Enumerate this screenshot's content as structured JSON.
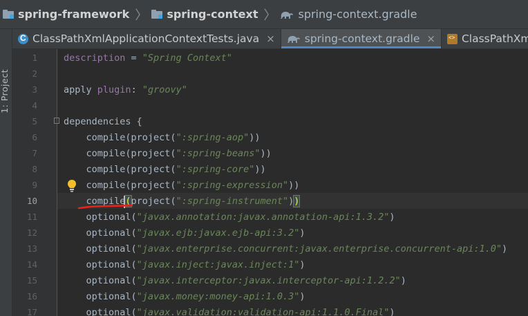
{
  "breadcrumb": {
    "items": [
      "spring-framework",
      "spring-context",
      "spring-context.gradle"
    ],
    "separator": "〉"
  },
  "tabs": [
    {
      "label": "ClassPathXmlApplicationContextTests.java",
      "icon": "java-class-icon",
      "active": false
    },
    {
      "label": "spring-context.gradle",
      "icon": "gradle-elephant-icon",
      "active": true
    },
    {
      "label": "ClassPathXmlAppl",
      "icon": "xml-file-icon",
      "active": false
    }
  ],
  "tab_close_glyph": "×",
  "toolwindow": {
    "project_label": "1: Project"
  },
  "gutter": {
    "line_numbers": [
      "1",
      "2",
      "3",
      "4",
      "5",
      "6",
      "7",
      "8",
      "9",
      "10",
      "11",
      "12",
      "13",
      "14",
      "15",
      "16",
      "17"
    ],
    "current_line": "10"
  },
  "code": {
    "line1": {
      "prop": "description",
      "op": " = ",
      "str": "\"Spring Context\""
    },
    "line3": {
      "fn": "apply ",
      "prop": "plugin",
      "op": ": ",
      "str": "\"groovy\""
    },
    "line5": {
      "text": "dependencies {"
    },
    "line6": {
      "fn": "    compile(project(",
      "str": "\":spring-aop\"",
      "end": "))"
    },
    "line7": {
      "fn": "    compile(project(",
      "str": "\":spring-beans\"",
      "end": "))"
    },
    "line8": {
      "fn": "    compile(project(",
      "str": "\":spring-core\"",
      "end": "))"
    },
    "line9": {
      "fn": "    compile(project(",
      "str": "\":spring-expression\"",
      "end": "))"
    },
    "line10": {
      "fn": "    compile",
      "lp": "(",
      "fn2": "project(",
      "str": "\":spring-instrument\"",
      "end1": ")",
      "rp": ")"
    },
    "line11": {
      "fn": "    optional(",
      "str": "\"javax.annotation:javax.annotation-api:1.3.2\"",
      "end": ")"
    },
    "line12": {
      "fn": "    optional(",
      "str": "\"javax.ejb:javax.ejb-api:3.2\"",
      "end": ")"
    },
    "line13": {
      "fn": "    optional(",
      "str": "\"javax.enterprise.concurrent:javax.enterprise.concurrent-api:1.0\"",
      "end": ")"
    },
    "line14": {
      "fn": "    optional(",
      "str": "\"javax.inject:javax.inject:1\"",
      "end": ")"
    },
    "line15": {
      "fn": "    optional(",
      "str": "\"javax.interceptor:javax.interceptor-api:1.2.2\"",
      "end": ")"
    },
    "line16": {
      "fn": "    optional(",
      "str": "\"javax.money:money-api:1.0.3\"",
      "end": ")"
    },
    "line17": {
      "fn": "    optional(",
      "str": "\"javax.validation:validation-api:1.1.0.Final\"",
      "end": ")"
    }
  },
  "colors": {
    "editor_bg": "#2b2b2b",
    "string": "#6a8759",
    "property": "#9876aa",
    "identifier": "#a9b7c6",
    "annotation_underline": "#e8231b",
    "bulb": "#f3c02c"
  }
}
